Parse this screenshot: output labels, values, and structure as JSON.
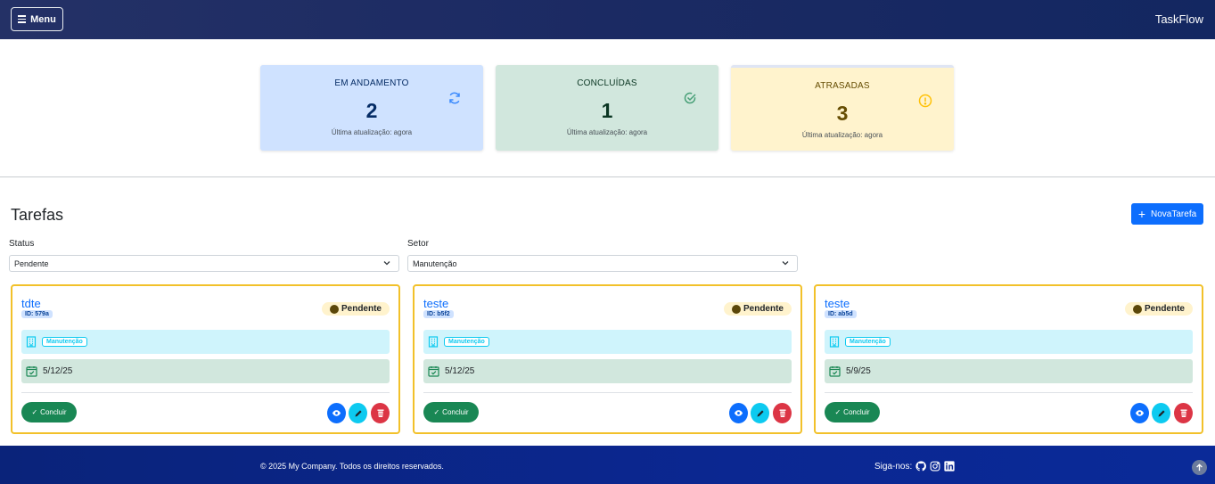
{
  "navbar": {
    "menu_label": "Menu",
    "brand": "TaskFlow"
  },
  "stats": [
    {
      "label": "EM ANDAMENTO",
      "count": "2",
      "updated": "Última atualização: agora",
      "icon": "refresh-icon",
      "color": "#cfe2ff"
    },
    {
      "label": "CONCLUÍDAS",
      "count": "1",
      "updated": "Última atualização: agora",
      "icon": "check-circle-icon",
      "color": "#d1e7dd"
    },
    {
      "label": "ATRASADAS",
      "count": "3",
      "updated": "Última atualização: agora",
      "icon": "exclamation-circle-icon",
      "color": "#fff3cd"
    }
  ],
  "tasks_section": {
    "title": "Tarefas",
    "new_task_label": "NovaTarefa"
  },
  "filters": {
    "status": {
      "label": "Status",
      "value": "Pendente"
    },
    "setor": {
      "label": "Setor",
      "value": "Manutenção"
    }
  },
  "cards": [
    {
      "title": "tdte",
      "id": "ID: 579a",
      "status": "Pendente",
      "setor": "Manutenção",
      "date": "5/12/25",
      "conclude_label": "Concluir"
    },
    {
      "title": "teste",
      "id": "ID: b5f2",
      "status": "Pendente",
      "setor": "Manutenção",
      "date": "5/12/25",
      "conclude_label": "Concluir"
    },
    {
      "title": "teste",
      "id": "ID: ab5d",
      "status": "Pendente",
      "setor": "Manutenção",
      "date": "5/9/25",
      "conclude_label": "Concluir"
    }
  ],
  "footer": {
    "copyright": "© 2025 My Company. Todos os direitos reservados.",
    "follow_label": "Siga-nos:"
  },
  "colors": {
    "accent": "#0d6efd",
    "card_border": "#f2c12a",
    "success": "#198754",
    "danger": "#dc3545",
    "info": "#0dcaf0"
  }
}
